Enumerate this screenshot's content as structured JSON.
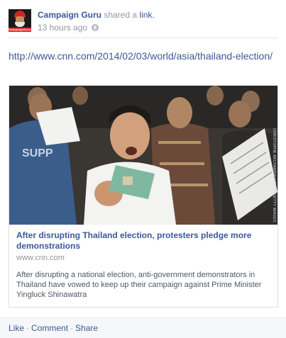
{
  "post": {
    "author": "Campaign Guru",
    "verb": "shared a",
    "object": "link.",
    "timestamp": "13 hours ago",
    "avatar_caption": "CampaignGuru",
    "shared_url": "http://www.cnn.com/2014/02/03/world/asia/thailand-election/"
  },
  "link_card": {
    "title": "After disrupting Thailand election, protesters pledge more demonstrations",
    "domain": "www.cnn.com",
    "description": "After disrupting a national election, anti-government demonstrators in Thailand have vowed to keep up their campaign against Prime Minister Yingluck Shinawatra",
    "image_credit": "CHRISTOPHE ARCHAMBAULT/AFP/GETTY IMAGES"
  },
  "actions": {
    "like": "Like",
    "comment": "Comment",
    "share": "Share",
    "separator": "·"
  },
  "icons": {
    "privacy": "globe-icon"
  },
  "colors": {
    "link_blue": "#3b5998",
    "meta_gray": "#9197a3",
    "footer_bg": "#f6f7f9"
  }
}
